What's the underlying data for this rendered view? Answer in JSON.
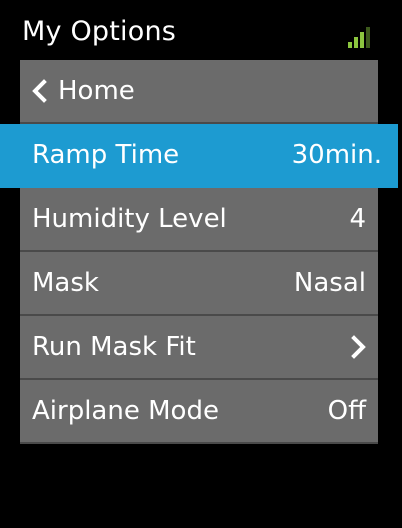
{
  "header": {
    "title": "My Options",
    "signal_icon": "signal-strength-icon",
    "signal_color": "#8cc63f"
  },
  "menu": {
    "home": {
      "label": "Home",
      "icon": "chevron-left-icon"
    },
    "items": [
      {
        "label": "Ramp Time",
        "value": "30min.",
        "selected": true
      },
      {
        "label": "Humidity Level",
        "value": "4"
      },
      {
        "label": "Mask",
        "value": "Nasal"
      },
      {
        "label": "Run Mask Fit",
        "value": "",
        "icon": "chevron-right-icon"
      },
      {
        "label": "Airplane Mode",
        "value": "Off"
      }
    ]
  },
  "colors": {
    "background": "#000000",
    "row": "#6b6b6b",
    "row_divider": "#4a4a4a",
    "selected": "#1d9bd1",
    "text": "#ffffff"
  }
}
